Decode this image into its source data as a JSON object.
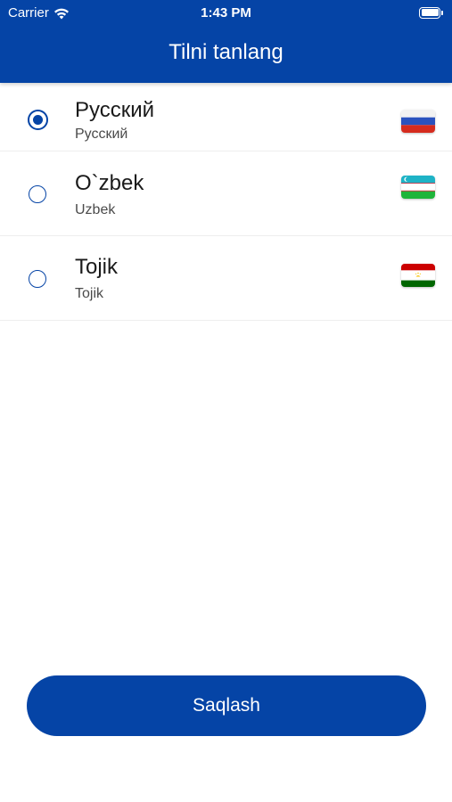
{
  "status_bar": {
    "carrier": "Carrier",
    "time": "1:43 PM"
  },
  "header": {
    "title": "Tilni tanlang"
  },
  "languages": [
    {
      "name": "Русский",
      "subtitle": "Русский",
      "selected": true,
      "flag": "russia-flag-icon"
    },
    {
      "name": "O`zbek",
      "subtitle": "Uzbek",
      "selected": false,
      "flag": "uzbekistan-flag-icon"
    },
    {
      "name": "Tojik",
      "subtitle": "Tojik",
      "selected": false,
      "flag": "tajikistan-flag-icon"
    }
  ],
  "save_button": {
    "label": "Saqlash"
  },
  "colors": {
    "primary": "#0544a6",
    "background": "#ffffff"
  }
}
